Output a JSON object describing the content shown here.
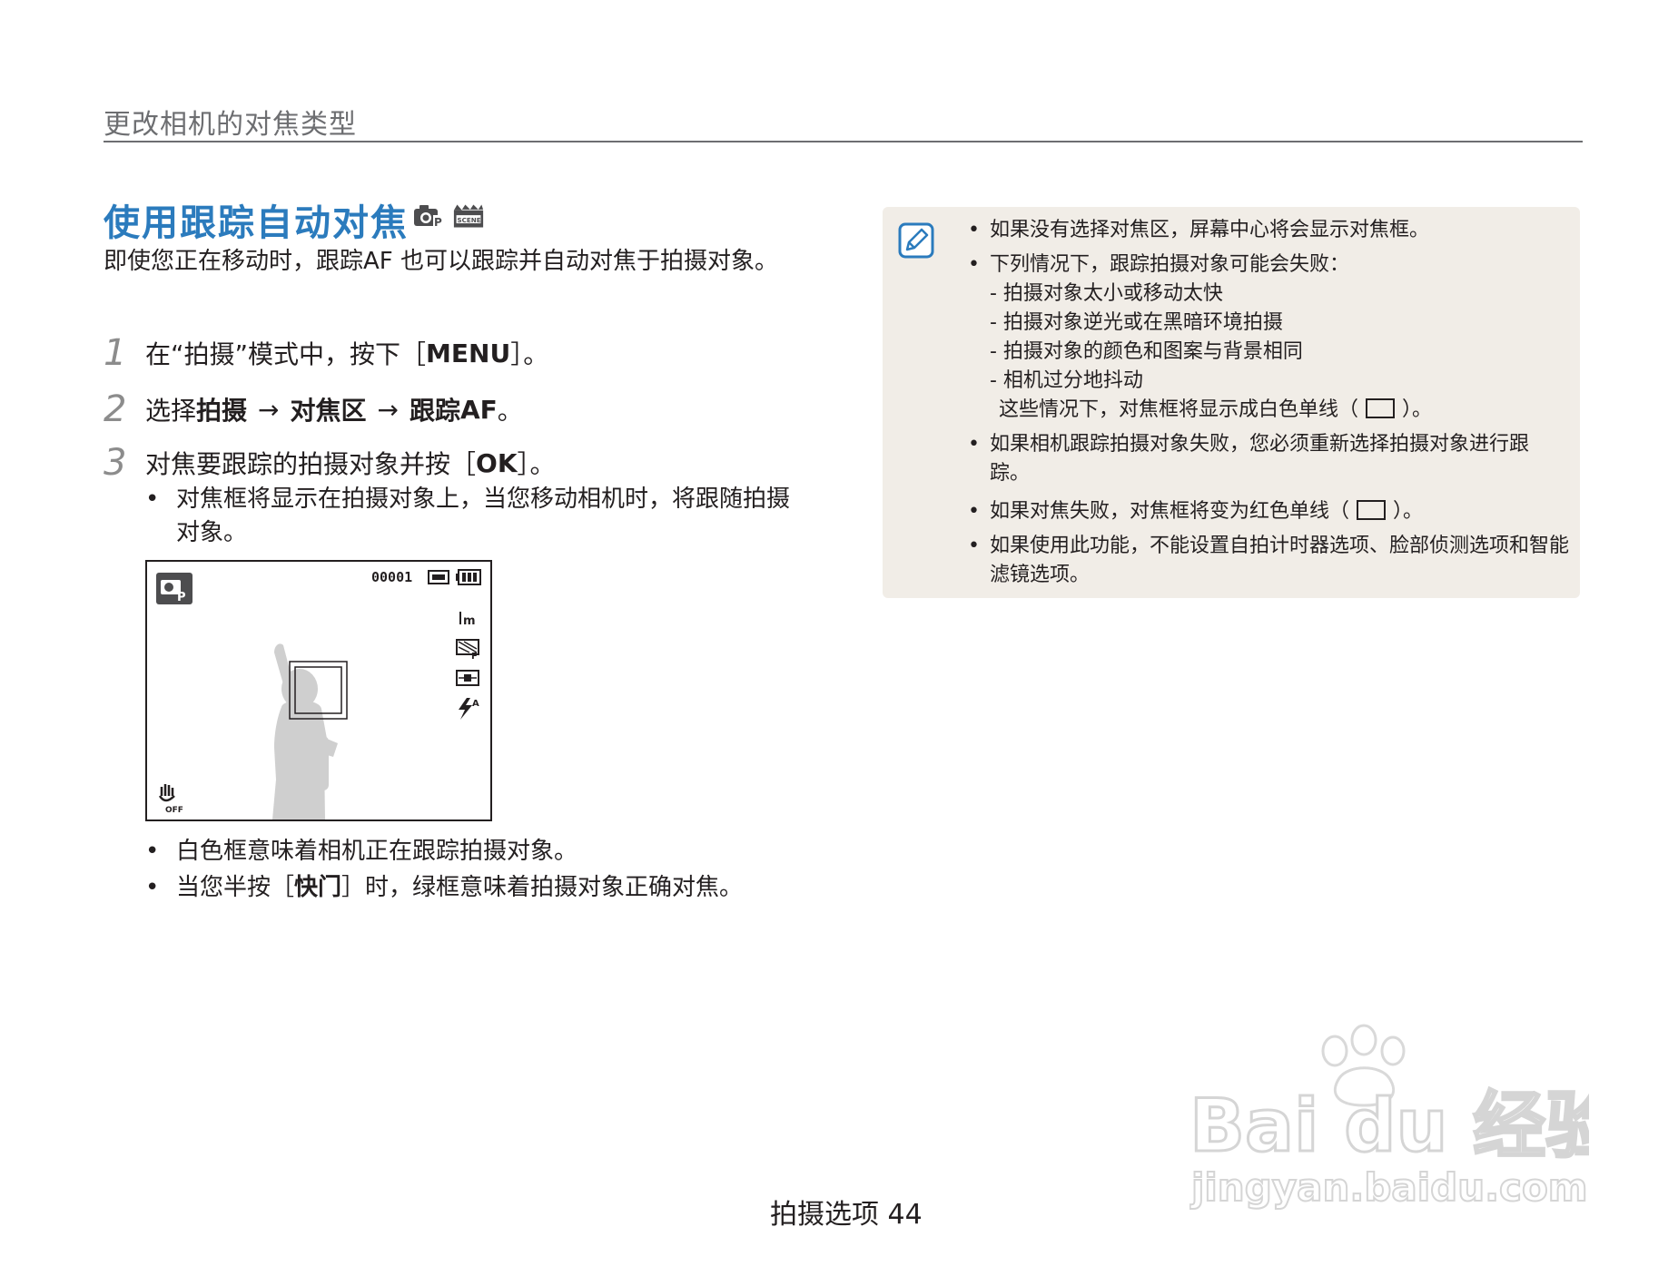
{
  "header": {
    "section": "更改相机的对焦类型"
  },
  "title": "使用跟踪自动对焦",
  "intro": "即使您正在移动时，跟踪AF 也可以跟踪并自动对焦于拍摄对象。",
  "steps": [
    {
      "num": "1",
      "prefix": "在“拍摄”模式中，按下［",
      "key": "MENU",
      "suffix": "］。"
    },
    {
      "num": "2",
      "prefix": "选择",
      "a": "拍摄",
      "arrow": "→",
      "b": "对焦区",
      "c": "跟踪",
      "c_suffix": "AF",
      "suffix": "。"
    },
    {
      "num": "3",
      "prefix": "对焦要跟踪的拍摄对象并按［",
      "key": "OK",
      "suffix": "］。"
    }
  ],
  "step3_bullet": "对焦框将显示在拍摄对象上，当您移动相机时，将跟随拍摄对象。",
  "screen": {
    "counter": "00001"
  },
  "after_bullets": [
    "白色框意味着相机正在跟踪拍摄对象。",
    {
      "prefix": "当您半按［",
      "key": "快门",
      "suffix": "］时，绿框意味着拍摄对象正确对焦。"
    }
  ],
  "note": {
    "bullet": "•",
    "items": [
      "如果没有选择对焦区，屏幕中心将会显示对焦框。",
      "下列情况下，跟踪拍摄对象可能会失败：",
      "如果相机跟踪拍摄对象失败，您必须重新选择拍摄对象进行跟踪。",
      "如果使用此功能，不能设置自拍计时器选项、脸部侦测选项和智能滤镜选项。"
    ],
    "sub_items": [
      "- 拍摄对象太小或移动太快",
      "- 拍摄对象逆光或在黑暗环境拍摄",
      "- 拍摄对象的颜色和图案与背景相同",
      "- 相机过分地抖动"
    ],
    "white_frame_line": {
      "prefix": "这些情况下，对焦框将显示成白色单线（",
      "suffix": "）。"
    },
    "red_frame_line": {
      "prefix": "如果对焦失败，对焦框将变为红色单线（",
      "suffix": "）。"
    }
  },
  "footer": {
    "label": "拍摄选项",
    "page": "44"
  },
  "watermark": {
    "brand": "Bai du 经验",
    "url": "jingyan.baidu.com"
  },
  "colors": {
    "title": "#2b7bbd",
    "note_bg": "#f1ede7",
    "header_gray": "#6d6e71"
  }
}
